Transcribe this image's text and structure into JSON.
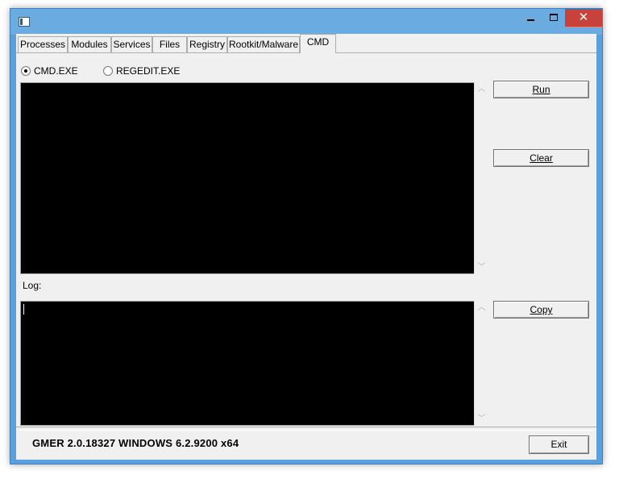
{
  "window": {
    "title": "",
    "controls": {
      "minimize": "—",
      "maximize": "□",
      "close": "✕"
    }
  },
  "tabs": [
    {
      "label": "Processes"
    },
    {
      "label": "Modules"
    },
    {
      "label": "Services"
    },
    {
      "label": "Files"
    },
    {
      "label": "Registry"
    },
    {
      "label": "Rootkit/Malware"
    },
    {
      "label": "CMD",
      "active": true
    }
  ],
  "cmd": {
    "radio_cmd": {
      "label": "CMD.EXE",
      "checked": true
    },
    "radio_regedit": {
      "label": "REGEDIT.EXE",
      "checked": false
    },
    "run_button": "Run",
    "clear_button": "Clear",
    "log_label": "Log:",
    "copy_button": "Copy"
  },
  "status": {
    "version_text": "GMER 2.0.18327    WINDOWS 6.2.9200  x64",
    "exit_button": "Exit"
  },
  "colors": {
    "titlebar": "#6aacdf",
    "close_button": "#c7423a",
    "console_bg": "#000000",
    "dialog_bg": "#f0f0f0"
  }
}
